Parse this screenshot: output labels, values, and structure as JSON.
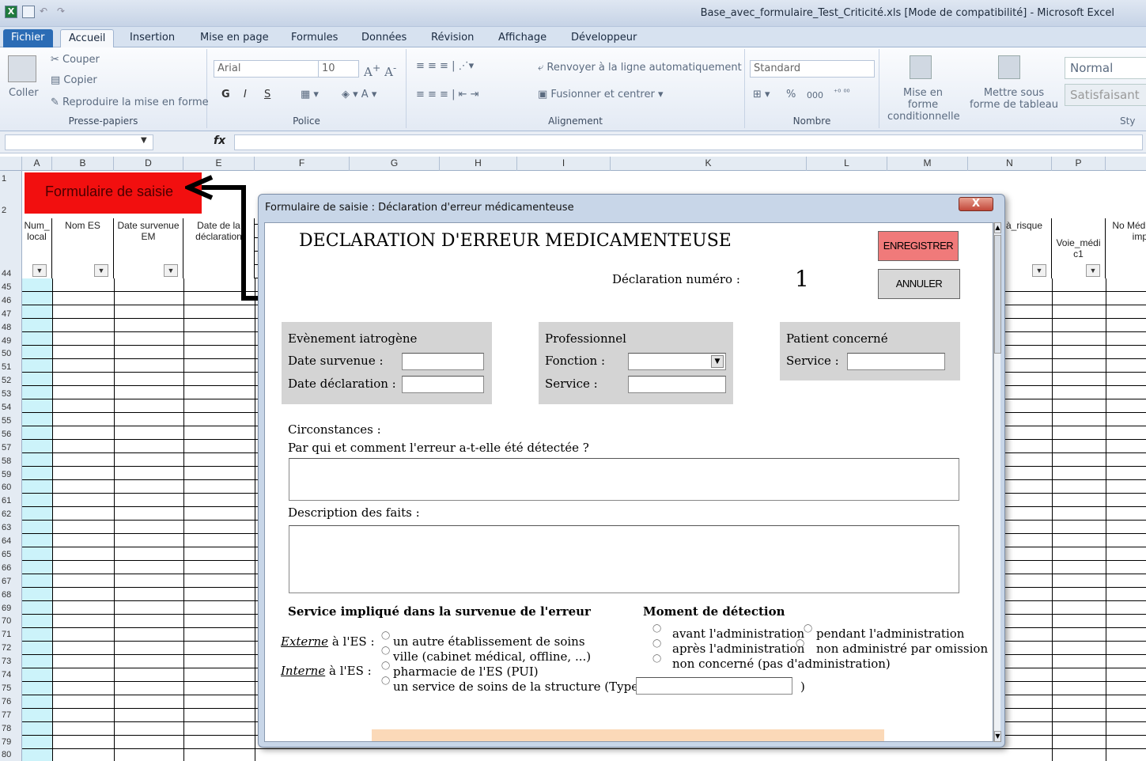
{
  "window": {
    "title": "Base_avec_formulaire_Test_Criticité.xls [Mode de compatibilité] - Microsoft Excel",
    "app_icon": "X"
  },
  "tabs": [
    "Fichier",
    "Accueil",
    "Insertion",
    "Mise en page",
    "Formules",
    "Données",
    "Révision",
    "Affichage",
    "Développeur"
  ],
  "ribbon": {
    "clipboard": {
      "paste": "Coller",
      "cut": "Couper",
      "copy": "Copier",
      "format_painter": "Reproduire la mise en forme",
      "label": "Presse-papiers"
    },
    "font": {
      "name": "Arial",
      "size": "10",
      "bold": "G",
      "italic": "I",
      "underline": "S",
      "label": "Police"
    },
    "alignment": {
      "wrap": "Renvoyer à la ligne automatiquement",
      "merge": "Fusionner et centrer",
      "label": "Alignement"
    },
    "number": {
      "format": "Standard",
      "percent": "%",
      "thousands": "000",
      "label": "Nombre"
    },
    "styles": {
      "conditional": "Mise en forme conditionnelle",
      "table": "Mettre sous forme de tableau",
      "normal": "Normal",
      "good": "Satisfaisant",
      "label": "Sty"
    }
  },
  "formula_bar": {
    "fx": "fx"
  },
  "columns": [
    "A",
    "B",
    "D",
    "E",
    "F",
    "G",
    "H",
    "I",
    "K",
    "L",
    "M",
    "N",
    "P"
  ],
  "rows": [
    "1",
    "2",
    "44",
    "45",
    "46",
    "47",
    "48",
    "49",
    "50",
    "51",
    "52",
    "53",
    "54",
    "55",
    "56",
    "57",
    "58",
    "59",
    "60",
    "61",
    "62",
    "63",
    "64",
    "65",
    "66",
    "67",
    "68",
    "69",
    "70",
    "71",
    "72",
    "73",
    "74",
    "75",
    "76",
    "77",
    "78",
    "79",
    "80"
  ],
  "sheet": {
    "form_button": "Formulaire de saisie",
    "headers": {
      "a": "Num_ local",
      "b": "Nom ES",
      "d": "Date survenue EM",
      "e": "Date de la déclaration",
      "n": "à_risque",
      "p": "Voie_médi c1",
      "q": "No Médi imp"
    }
  },
  "dialog": {
    "title": "Formulaire de saisie : Déclaration d'erreur médicamenteuse",
    "close": "X",
    "heading": "DECLARATION D'ERREUR MEDICAMENTEUSE",
    "save": "ENREGISTRER",
    "cancel": "ANNULER",
    "decl_label": "Déclaration numéro :",
    "decl_number": "1",
    "event": {
      "title": "Evènement iatrogène",
      "date_survenue": "Date survenue :",
      "date_declaration": "Date déclaration :"
    },
    "pro": {
      "title": "Professionnel",
      "fonction": "Fonction :",
      "service": "Service :"
    },
    "patient": {
      "title": "Patient concerné",
      "service": "Service :"
    },
    "circ_title": "Circonstances :",
    "circ_question": "Par qui et comment l'erreur a-t-elle été détectée ?",
    "desc_label": "Description des faits :",
    "service_title": "Service impliqué dans la survenue de l'erreur",
    "externe": "Externe",
    "externe_suffix": "à l'ES :",
    "interne": "Interne",
    "interne_suffix": "à l'ES :",
    "opt_autre": "un autre établissement de soins",
    "opt_ville": "ville (cabinet médical, offline, ...)",
    "opt_pharmacie": "pharmacie de l'ES (PUI)",
    "opt_service": "un service de soins de la structure (Type :",
    "opt_paren": ")",
    "moment_title": "Moment de détection",
    "m_avant": "avant l'administration",
    "m_pendant": "pendant l'administration",
    "m_apres": "après l'administration",
    "m_non_admin": "non administré par omission",
    "m_non_concerne": "non concerné (pas d'administration)"
  }
}
